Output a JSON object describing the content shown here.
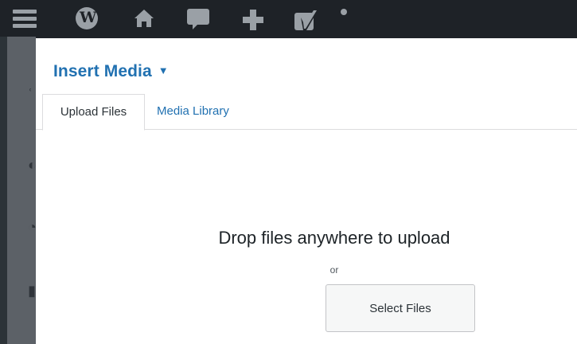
{
  "admin_bar": {
    "icons": [
      "menu-icon",
      "wordpress-icon",
      "home-icon",
      "comment-icon",
      "plus-icon",
      "yoast-icon",
      "notification-dot"
    ]
  },
  "modal": {
    "title": "Insert Media",
    "title_caret": "▼",
    "tabs": [
      {
        "label": "Upload Files",
        "active": true
      },
      {
        "label": "Media Library",
        "active": false
      }
    ],
    "drop_text": "Drop files anywhere to upload",
    "or_text": "or",
    "select_button_label": "Select Files"
  },
  "colors": {
    "admin_bar_bg": "#1e2227",
    "link_blue": "#2171b1",
    "backdrop": "#5c6167"
  }
}
